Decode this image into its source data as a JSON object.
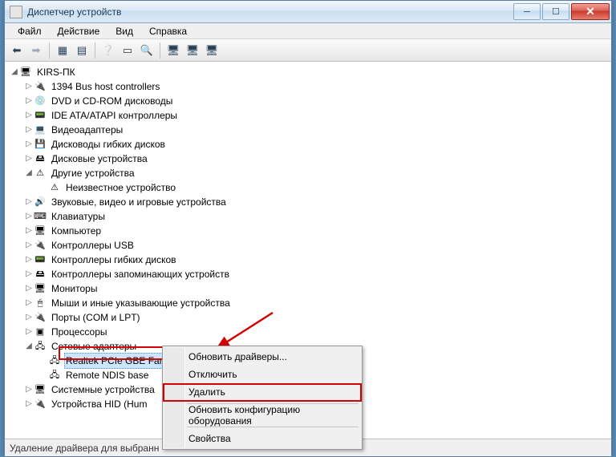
{
  "window": {
    "title": "Диспетчер устройств"
  },
  "menu": {
    "file": "Файл",
    "action": "Действие",
    "view": "Вид",
    "help": "Справка"
  },
  "tree": {
    "root": "KIRS-ПК",
    "items": [
      {
        "icon": "🔌",
        "label": "1394 Bus host controllers"
      },
      {
        "icon": "💿",
        "label": "DVD и CD-ROM дисководы"
      },
      {
        "icon": "📟",
        "label": "IDE ATA/ATAPI контроллеры"
      },
      {
        "icon": "💻",
        "label": "Видеоадаптеры"
      },
      {
        "icon": "💾",
        "label": "Дисководы гибких дисков"
      },
      {
        "icon": "🖴",
        "label": "Дисковые устройства"
      }
    ],
    "other": "Другие устройства",
    "unknown": "Неизвестное устройство",
    "items2": [
      {
        "icon": "🔊",
        "label": "Звуковые, видео и игровые устройства"
      },
      {
        "icon": "⌨",
        "label": "Клавиатуры"
      },
      {
        "icon": "🖥",
        "label": "Компьютер"
      },
      {
        "icon": "🔌",
        "label": "Контроллеры USB"
      },
      {
        "icon": "📟",
        "label": "Контроллеры гибких дисков"
      },
      {
        "icon": "🖴",
        "label": "Контроллеры запоминающих устройств"
      },
      {
        "icon": "🖥",
        "label": "Мониторы"
      },
      {
        "icon": "🖱",
        "label": "Мыши и иные указывающие устройства"
      },
      {
        "icon": "🔌",
        "label": "Порты (COM и LPT)"
      },
      {
        "icon": "▣",
        "label": "Процессоры"
      }
    ],
    "network": "Сетевые адаптеры",
    "netchild": [
      "Realtek PCIe GBE Family Controller",
      "Remote NDIS base"
    ],
    "items3": [
      {
        "icon": "🖥",
        "label": "Системные устройства"
      },
      {
        "icon": "🔌",
        "label": "Устройства HID (Hum"
      }
    ]
  },
  "ctx": {
    "update": "Обновить драйверы...",
    "disable": "Отключить",
    "remove": "Удалить",
    "scan": "Обновить конфигурацию оборудования",
    "props": "Свойства"
  },
  "status": "Удаление драйвера для выбранн"
}
